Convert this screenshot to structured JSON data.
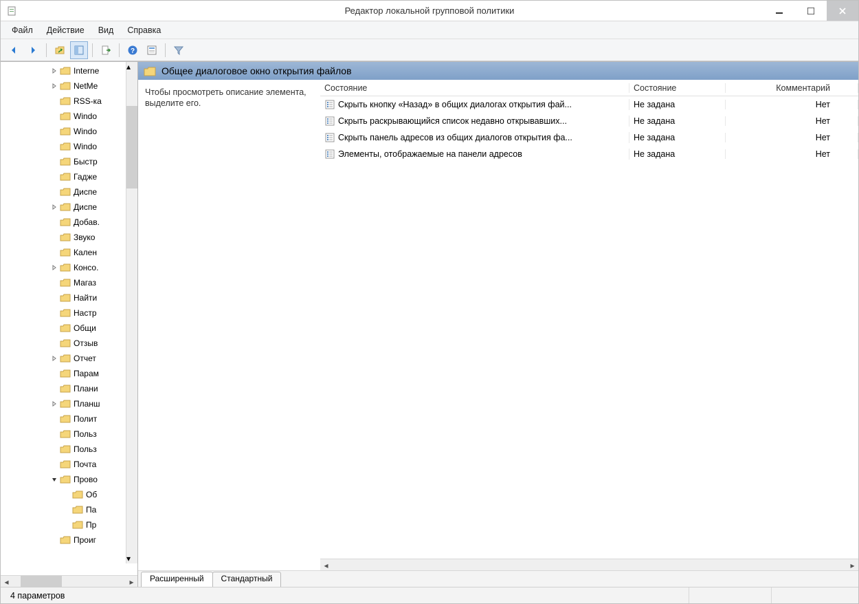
{
  "window": {
    "title": "Редактор локальной групповой политики"
  },
  "menu": {
    "file": "Файл",
    "action": "Действие",
    "view": "Вид",
    "help": "Справка"
  },
  "content_header": "Общее диалоговое окно открытия файлов",
  "description_hint": "Чтобы просмотреть описание элемента, выделите его.",
  "columns": {
    "name": "Состояние",
    "state": "Состояние",
    "comment": "Комментарий"
  },
  "policies": [
    {
      "name": "Скрыть кнопку «Назад» в общих диалогах открытия фай...",
      "state": "Не задана",
      "comment": "Нет"
    },
    {
      "name": "Скрыть раскрывающийся список недавно открывавших...",
      "state": "Не задана",
      "comment": "Нет"
    },
    {
      "name": "Скрыть панель адресов из общих диалогов открытия фа...",
      "state": "Не задана",
      "comment": "Нет"
    },
    {
      "name": "Элементы, отображаемые на панели адресов",
      "state": "Не задана",
      "comment": "Нет"
    }
  ],
  "tree": [
    {
      "indent": 4,
      "expander": "right",
      "label": "Interne"
    },
    {
      "indent": 4,
      "expander": "right",
      "label": "NetMe"
    },
    {
      "indent": 4,
      "expander": "",
      "label": "RSS-ка"
    },
    {
      "indent": 4,
      "expander": "",
      "label": "Windo"
    },
    {
      "indent": 4,
      "expander": "",
      "label": "Windo"
    },
    {
      "indent": 4,
      "expander": "",
      "label": "Windo"
    },
    {
      "indent": 4,
      "expander": "",
      "label": "Быстр"
    },
    {
      "indent": 4,
      "expander": "",
      "label": "Гадже"
    },
    {
      "indent": 4,
      "expander": "",
      "label": "Диспе"
    },
    {
      "indent": 4,
      "expander": "right",
      "label": "Диспе"
    },
    {
      "indent": 4,
      "expander": "",
      "label": "Добав."
    },
    {
      "indent": 4,
      "expander": "",
      "label": "Звуко"
    },
    {
      "indent": 4,
      "expander": "",
      "label": "Кален"
    },
    {
      "indent": 4,
      "expander": "right",
      "label": "Консо."
    },
    {
      "indent": 4,
      "expander": "",
      "label": "Магаз"
    },
    {
      "indent": 4,
      "expander": "",
      "label": "Найти"
    },
    {
      "indent": 4,
      "expander": "",
      "label": "Настр"
    },
    {
      "indent": 4,
      "expander": "",
      "label": "Общи"
    },
    {
      "indent": 4,
      "expander": "",
      "label": "Отзыв"
    },
    {
      "indent": 4,
      "expander": "right",
      "label": "Отчет"
    },
    {
      "indent": 4,
      "expander": "",
      "label": "Парам"
    },
    {
      "indent": 4,
      "expander": "",
      "label": "Плани"
    },
    {
      "indent": 4,
      "expander": "right",
      "label": "Планш"
    },
    {
      "indent": 4,
      "expander": "",
      "label": "Полит"
    },
    {
      "indent": 4,
      "expander": "",
      "label": "Польз"
    },
    {
      "indent": 4,
      "expander": "",
      "label": "Польз"
    },
    {
      "indent": 4,
      "expander": "",
      "label": "Почта"
    },
    {
      "indent": 4,
      "expander": "down",
      "label": "Прово"
    },
    {
      "indent": 5,
      "expander": "",
      "label": "Об"
    },
    {
      "indent": 5,
      "expander": "",
      "label": "Па"
    },
    {
      "indent": 5,
      "expander": "",
      "label": "Пр"
    },
    {
      "indent": 4,
      "expander": "",
      "label": "Проиг"
    }
  ],
  "tabs": {
    "extended": "Расширенный",
    "standard": "Стандартный",
    "active": "extended"
  },
  "statusbar": {
    "text": "4 параметров"
  }
}
